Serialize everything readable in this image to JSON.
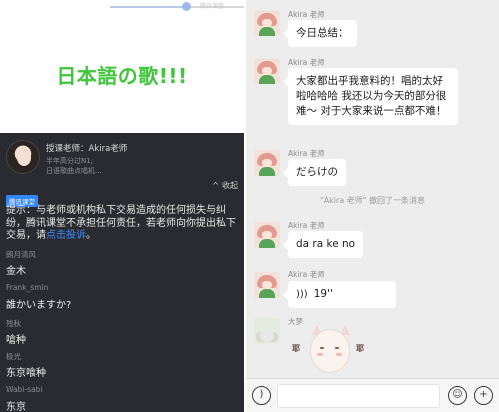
{
  "left_panel": {
    "video": {
      "watermark": "腾讯课堂",
      "title": "日本語の歌!!!",
      "progress": 0.57
    },
    "teacher": {
      "label": "授课老师：Akira老师",
      "sub1": "半年高分过N1;",
      "sub2": "日语歌曲点唱机..."
    },
    "collapse_label": "收起",
    "notice": {
      "tag": "腾讯课堂",
      "text": "提示：与老师或机构私下交易造成的任何损失与纠纷，腾讯课堂不承担任何责任，若老师向你提出私下交易，请",
      "link": "点击投诉",
      "tail": "。"
    },
    "messages": [
      {
        "name": "朗月清风",
        "text": "金木"
      },
      {
        "name": "Frank_smin",
        "text": "誰かいますか?"
      },
      {
        "name": "残秋",
        "text": "嗆种"
      },
      {
        "name": "极光",
        "text": "东京喰种"
      },
      {
        "name": "Wabi-sabi",
        "text": "东京"
      }
    ]
  },
  "right_panel": {
    "messages": [
      {
        "sender": "Akira 老师",
        "text": "今日总结："
      },
      {
        "sender": "Akira 老师",
        "text": "大家都出乎我意料的！唱的太好啦哈哈哈 我还以为今天的部分很难～ 对于大家来说一点都不难！"
      },
      {
        "sender": "Akira 老师",
        "text": "だらけの"
      },
      {
        "sender": "Akira 老师",
        "text": "da ra ke no"
      },
      {
        "sender": "Akira 老师",
        "text": "19''"
      }
    ],
    "recall_notice": "\"Akira 老师\" 撤回了一条消息",
    "sticker_sender": "大梦",
    "sticker_sfx1": "耶",
    "sticker_sfx2": "耶",
    "icons": {
      "voice": "voice-wave-icon",
      "mic": "voice-input-icon",
      "emoji": "emoji-icon",
      "plus": "plus-icon"
    }
  }
}
